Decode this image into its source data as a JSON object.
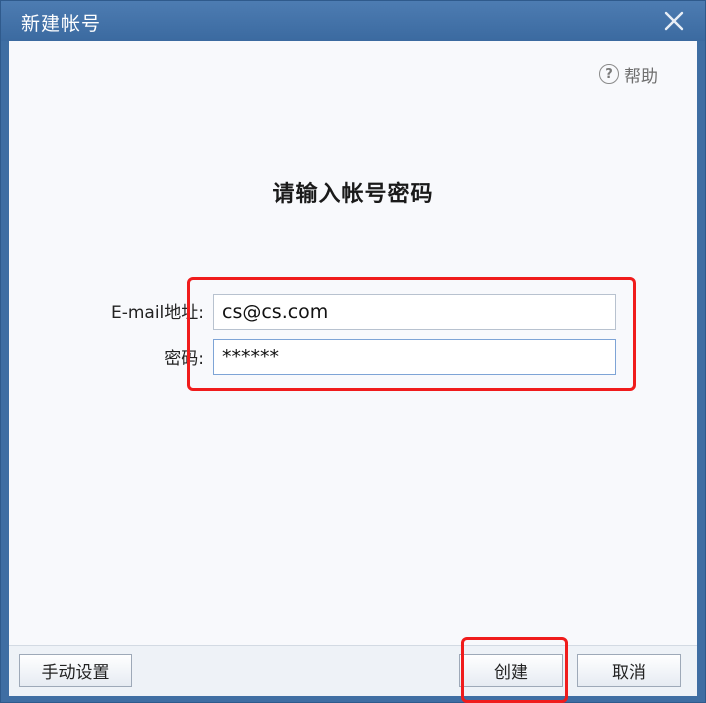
{
  "window": {
    "title": "新建帐号"
  },
  "help": {
    "label": "帮助",
    "icon": "question-circle-icon"
  },
  "main": {
    "heading": "请输入帐号密码",
    "email_label": "E-mail地址:",
    "email_value": "cs@cs.com",
    "password_label": "密码:",
    "password_value": "******"
  },
  "footer": {
    "manual_label": "手动设置",
    "create_label": "创建",
    "cancel_label": "取消"
  },
  "colors": {
    "titlebar": "#3f6ea3",
    "highlight": "#f01c1c",
    "content_bg": "#f8f9fc"
  }
}
